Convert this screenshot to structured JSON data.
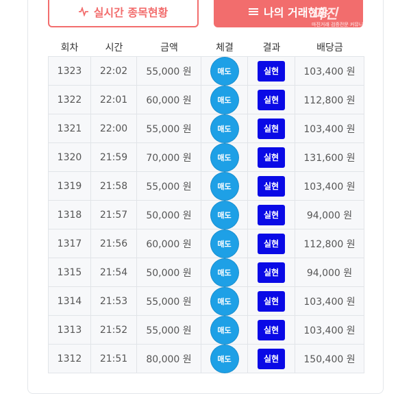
{
  "tabs": {
    "live_label": "실시간 종목현황",
    "mine_label": "나의 거래현황"
  },
  "watermark": {
    "title": "마진",
    "subtitle": "마진거래 검증전문 커뮤니티"
  },
  "table": {
    "headers": [
      "회차",
      "시간",
      "금액",
      "체결",
      "결과",
      "배당금"
    ],
    "rows": [
      {
        "round": "1323",
        "time": "22:02",
        "amount": "55,000 원",
        "trade": "매도",
        "result": "실현",
        "payout": "103,400 원"
      },
      {
        "round": "1322",
        "time": "22:01",
        "amount": "60,000 원",
        "trade": "매도",
        "result": "실현",
        "payout": "112,800 원"
      },
      {
        "round": "1321",
        "time": "22:00",
        "amount": "55,000 원",
        "trade": "매도",
        "result": "실현",
        "payout": "103,400 원"
      },
      {
        "round": "1320",
        "time": "21:59",
        "amount": "70,000 원",
        "trade": "매도",
        "result": "실현",
        "payout": "131,600 원"
      },
      {
        "round": "1319",
        "time": "21:58",
        "amount": "55,000 원",
        "trade": "매도",
        "result": "실현",
        "payout": "103,400 원"
      },
      {
        "round": "1318",
        "time": "21:57",
        "amount": "50,000 원",
        "trade": "매도",
        "result": "실현",
        "payout": "94,000 원"
      },
      {
        "round": "1317",
        "time": "21:56",
        "amount": "60,000 원",
        "trade": "매도",
        "result": "실현",
        "payout": "112,800 원"
      },
      {
        "round": "1315",
        "time": "21:54",
        "amount": "50,000 원",
        "trade": "매도",
        "result": "실현",
        "payout": "94,000 원"
      },
      {
        "round": "1314",
        "time": "21:53",
        "amount": "55,000 원",
        "trade": "매도",
        "result": "실현",
        "payout": "103,400 원"
      },
      {
        "round": "1313",
        "time": "21:52",
        "amount": "55,000 원",
        "trade": "매도",
        "result": "실현",
        "payout": "103,400 원"
      },
      {
        "round": "1312",
        "time": "21:51",
        "amount": "80,000 원",
        "trade": "매도",
        "result": "실현",
        "payout": "150,400 원"
      }
    ]
  },
  "colors": {
    "accent": "#f26d6d",
    "trade_circle": "#1ea0e6",
    "result_badge": "#0a0ae6"
  },
  "icons": {
    "live_tab": "pulse-icon",
    "mine_tab": "list-icon"
  }
}
